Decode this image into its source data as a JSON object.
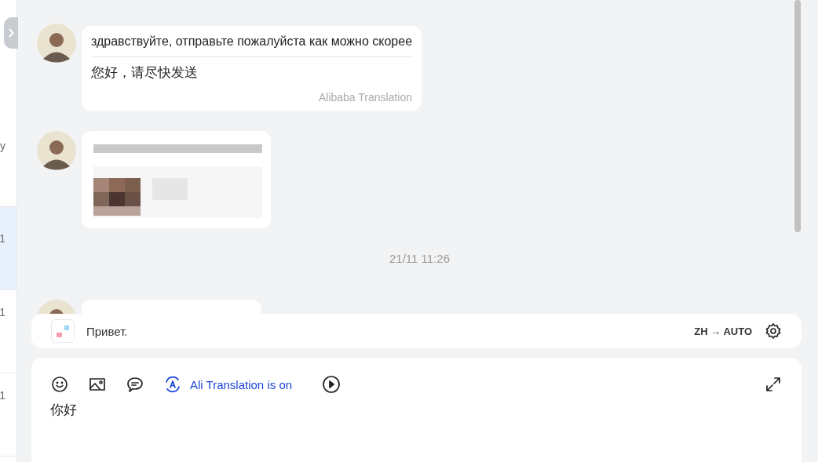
{
  "sidebar": {
    "items": [
      {
        "text": "y",
        "selected": false
      },
      {
        "text": "1",
        "selected": true
      },
      {
        "text": "1",
        "selected": false
      },
      {
        "text": "1",
        "selected": false
      }
    ]
  },
  "messages": [
    {
      "kind": "translated",
      "original": "здравствуйте, отправьте пожалуйста  как можно скорее",
      "translation": "您好，请尽快发送",
      "source": "Alibaba Translation"
    },
    {
      "kind": "blurred"
    },
    {
      "kind": "timestamp",
      "text": "21/11 11:26"
    },
    {
      "kind": "partial"
    }
  ],
  "translation_bar": {
    "text": "Привет.",
    "languages": "ZH → AUTO"
  },
  "composer": {
    "translation_label": "Ali Translation is on",
    "translation_on": true,
    "value": "你好"
  }
}
